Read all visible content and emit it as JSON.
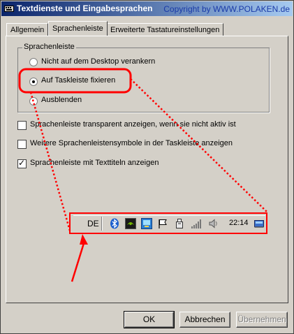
{
  "window": {
    "title": "Textdienste und Eingabesprachen",
    "copyright": "Copyright by WWW.POLAKEN.de"
  },
  "tabs": [
    {
      "label": "Allgemein",
      "active": false
    },
    {
      "label": "Sprachenleiste",
      "active": true
    },
    {
      "label": "Erweiterte Tastatureinstellungen",
      "active": false
    }
  ],
  "group": {
    "label": "Sprachenleiste",
    "options": [
      {
        "label": "Nicht auf dem Desktop verankern",
        "selected": false
      },
      {
        "label": "Auf Taskleiste fixieren",
        "selected": true
      },
      {
        "label": "Ausblenden",
        "selected": false
      }
    ]
  },
  "checkboxes": [
    {
      "label": "Sprachenleiste transparent anzeigen, wenn sie nicht aktiv ist",
      "checked": false
    },
    {
      "label": "Weitere Sprachenleistensymbole in der Taskleiste anzeigen",
      "checked": false
    },
    {
      "label": "Sprachenleiste mit Texttiteln anzeigen",
      "checked": true
    }
  ],
  "taskbar": {
    "language": "DE",
    "clock": "22:14",
    "tray_icons": [
      "bluetooth-icon",
      "nvidia-icon",
      "network-app-icon",
      "flag-icon",
      "usb-icon",
      "signal-icon",
      "volume-icon",
      "desktop-icon"
    ]
  },
  "buttons": {
    "ok": "OK",
    "cancel": "Abbrechen",
    "apply": "Übernehmen"
  },
  "colors": {
    "annotation": "#ff0000",
    "title_bar": "#0a246a",
    "copyright": "#1a3aa8",
    "face": "#d4d0c8"
  }
}
